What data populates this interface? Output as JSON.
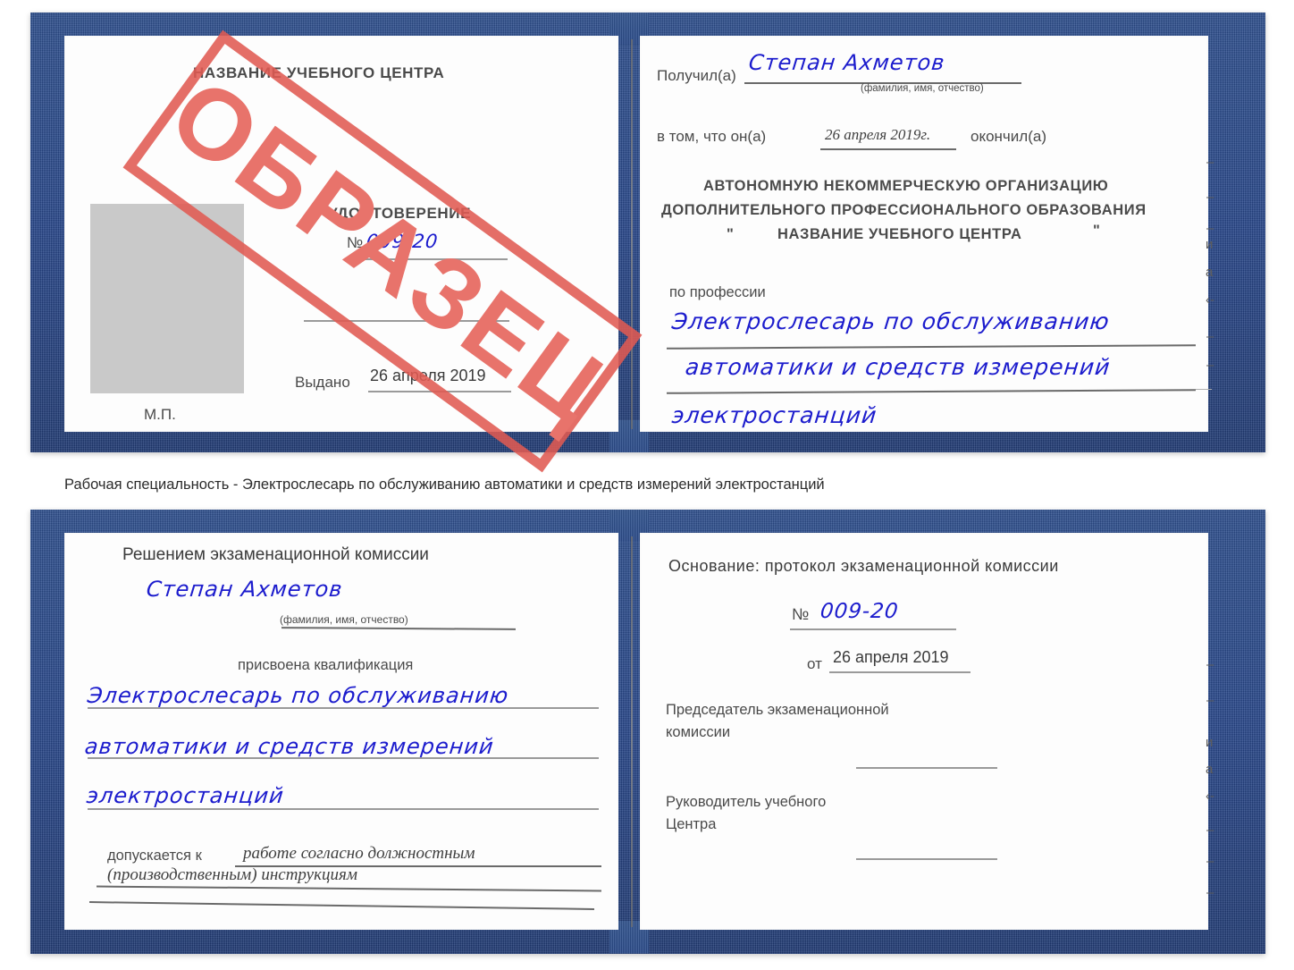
{
  "document": {
    "type": "certificate-scan",
    "language": "ru",
    "watermark": "ОБРАЗЕЦ",
    "colors": {
      "cover_blue": "#27468a",
      "stamp_red": "#e05a52",
      "handwriting_blue": "#1c1ccd",
      "photo_placeholder_gray": "#c9c9c9",
      "paper_white": "#fdfdfd",
      "rule_gray": "#9a9a9a"
    }
  },
  "caption": {
    "text": "Рабочая специальность - Электрослесарь по обслуживанию автоматики и средств измерений электростанций"
  },
  "certificate_top": {
    "left_page": {
      "org_title": "НАЗВАНИЕ УЧЕБНОГО ЦЕНТРА",
      "doc_title": "УДОСТОВЕРЕНИЕ",
      "number_label": "№",
      "number_value": "009-20",
      "issued_label": "Выдано",
      "issued_value": "26 апреля 2019",
      "seal_label": "М.П.",
      "photo_placeholder": ""
    },
    "right_page": {
      "received_label": "Получил(а)",
      "received_value": "Степан Ахметов",
      "received_hint": "(фамилия, имя, отчество)",
      "that_he_label": "в том, что он(а)",
      "that_he_value": "26 апреля 2019г.",
      "finished_label": "окончил(а)",
      "org_line1": "АВТОНОМНУЮ НЕКОММЕРЧЕСКУЮ ОРГАНИЗАЦИЮ",
      "org_line2": "ДОПОЛНИТЕЛЬНОГО ПРОФЕССИОНАЛЬНОГО ОБРАЗОВАНИЯ",
      "org_quote_open": "\"",
      "org_line3": "НАЗВАНИЕ УЧЕБНОГО ЦЕНТРА",
      "org_quote_close": "\"",
      "profession_label": "по профессии",
      "profession_line1": "Электрослесарь по обслуживанию",
      "profession_line2": "автоматики и средств измерений",
      "profession_line3": "электростанций"
    },
    "edge_marks": [
      "–",
      "–",
      "–",
      "и",
      "а",
      "‹-",
      "–",
      "–"
    ]
  },
  "certificate_bottom": {
    "left_page": {
      "decision_title": "Решением экзаменационной комиссии",
      "name_value": "Степан Ахметов",
      "name_hint": "(фамилия, имя, отчество)",
      "qualification_label": "присвоена квалификация",
      "qualification_line1": "Электрослесарь по обслуживанию",
      "qualification_line2": "автоматики и средств измерений",
      "qualification_line3": "электростанций",
      "admitted_label": "допускается к",
      "admitted_line1": "работе согласно должностным",
      "admitted_line2": "(производственным) инструкциям"
    },
    "right_page": {
      "basis_label": "Основание: протокол экзаменационной комиссии",
      "number_label": "№",
      "number_value": "009-20",
      "date_label": "от",
      "date_value": "26 апреля 2019",
      "chairman_line1": "Председатель экзаменационной",
      "chairman_line2": "комиссии",
      "head_line1": "Руководитель учебного",
      "head_line2": "Центра"
    },
    "edge_marks": [
      "–",
      "–",
      "и",
      "а",
      "‹-",
      "–",
      "–",
      "–"
    ]
  }
}
